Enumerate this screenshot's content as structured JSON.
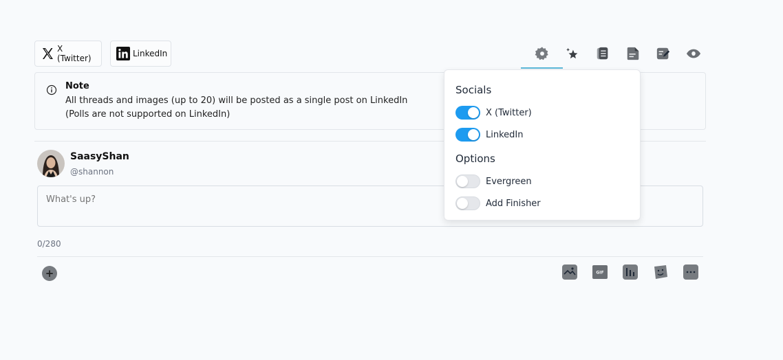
{
  "platforms": [
    {
      "label": "X (Twitter)",
      "icon": "x-logo-icon"
    },
    {
      "label": "LinkedIn",
      "icon": "linkedin-logo-icon"
    }
  ],
  "toolbar": {
    "icons": [
      "settings-gear-icon",
      "star-sparkle-icon",
      "document-list-icon",
      "file-text-icon",
      "edit-note-icon",
      "preview-eye-icon"
    ]
  },
  "note": {
    "title": "Note",
    "line1": "All threads and images (up to 20) will be posted as a single post on LinkedIn",
    "line2": "(Polls are not supported on LinkedIn)"
  },
  "user": {
    "name": "SaasyShan",
    "handle": "@shannon"
  },
  "composer": {
    "placeholder": "What's up?",
    "char_count": "0/280"
  },
  "bottom_toolbar": {
    "add_label": "+",
    "icons": [
      "image-icon",
      "gif-icon",
      "poll-chart-icon",
      "emoji-icon",
      "more-icon"
    ],
    "gif_label": "GIF"
  },
  "popover": {
    "socials_heading": "Socials",
    "socials": [
      {
        "label": "X (Twitter)",
        "on": true
      },
      {
        "label": "LinkedIn",
        "on": true
      }
    ],
    "options_heading": "Options",
    "options": [
      {
        "label": "Evergreen",
        "on": false
      },
      {
        "label": "Add Finisher",
        "on": false
      }
    ]
  },
  "colors": {
    "toggle_on": "#1d9bf0",
    "tab_underline": "#5bb8d9",
    "icon_gray": "#777b80"
  }
}
